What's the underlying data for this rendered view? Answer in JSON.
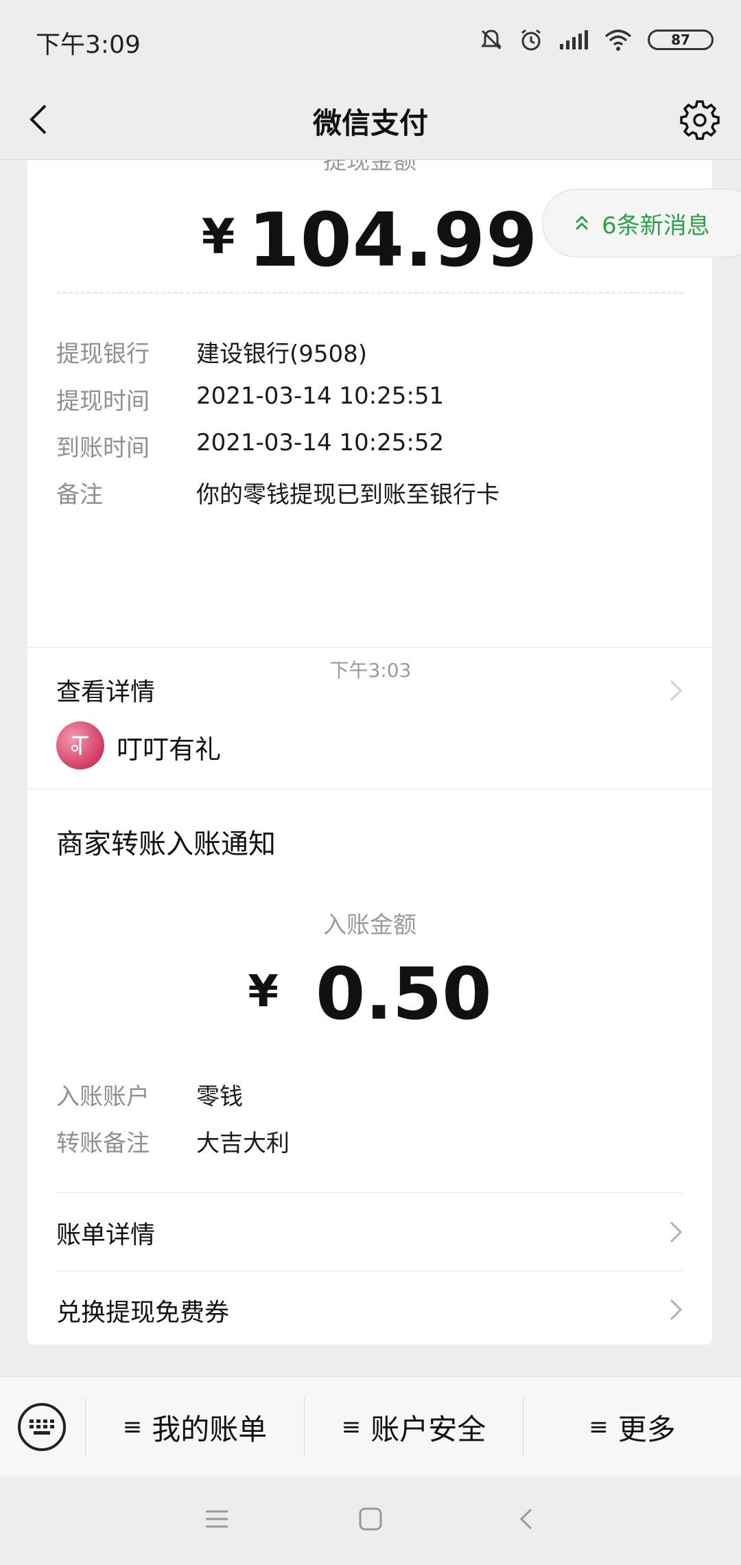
{
  "status_bar": {
    "time": "下午3:09",
    "battery": "87"
  },
  "nav": {
    "title": "微信支付"
  },
  "new_messages": {
    "label": "6条新消息"
  },
  "withdrawal_card": {
    "label": "提现金额",
    "currency": "¥",
    "amount": "104.99",
    "rows": [
      {
        "key": "提现银行",
        "value": "建设银行(9508)"
      },
      {
        "key": "提现时间",
        "value": "2021-03-14 10:25:51"
      },
      {
        "key": "到账时间",
        "value": "2021-03-14 10:25:52"
      },
      {
        "key": "备注",
        "value": "你的零钱提现已到账至银行卡"
      }
    ],
    "detail_link": "查看详情"
  },
  "timestamp": "下午3:03",
  "merchant_card": {
    "merchant_name": "叮叮有礼",
    "title": "商家转账入账通知",
    "label": "入账金额",
    "currency": "¥",
    "amount": "0.50",
    "rows": [
      {
        "key": "入账账户",
        "value": "零钱"
      },
      {
        "key": "转账备注",
        "value": "大吉大利"
      }
    ],
    "links": [
      "账单详情",
      "兑换提现免费券"
    ]
  },
  "bottom_menu": {
    "lines_glyph": "≡",
    "items": [
      "我的账单",
      "账户安全",
      "更多"
    ]
  },
  "colors": {
    "accent": "#2ba245",
    "background": "#ededed",
    "card": "#ffffff"
  }
}
